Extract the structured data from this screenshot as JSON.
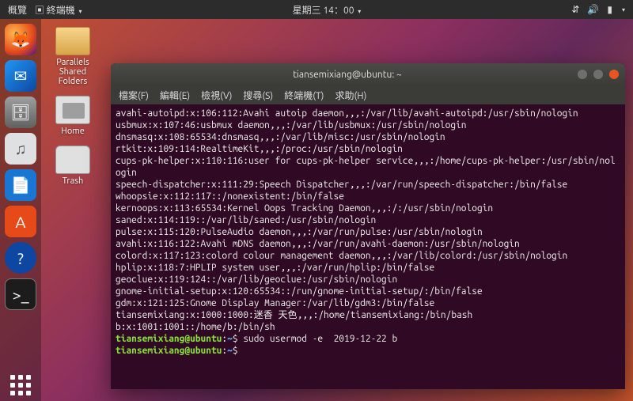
{
  "panel": {
    "activities": "概覽",
    "app_menu": "終端機",
    "clock": "星期三 14：00"
  },
  "desktop": {
    "parallels": "Parallels\nShared\nFolders",
    "home": "Home",
    "trash": "Trash"
  },
  "terminal": {
    "title": "tiansemixiang@ubuntu: ~",
    "menus": [
      "檔案(F)",
      "編輯(E)",
      "檢視(V)",
      "搜尋(S)",
      "終端機(T)",
      "求助(H)"
    ],
    "lines": [
      "avahi-autoipd:x:106:112:Avahi autoip daemon,,,:/var/lib/avahi-autoipd:/usr/sbin/nologin",
      "usbmux:x:107:46:usbmux daemon,,,:/var/lib/usbmux:/usr/sbin/nologin",
      "dnsmasq:x:108:65534:dnsmasq,,,:/var/lib/misc:/usr/sbin/nologin",
      "rtkit:x:109:114:RealtimeKit,,,:/proc:/usr/sbin/nologin",
      "cups-pk-helper:x:110:116:user for cups-pk-helper service,,,:/home/cups-pk-helper:/usr/sbin/nologin",
      "speech-dispatcher:x:111:29:Speech Dispatcher,,,:/var/run/speech-dispatcher:/bin/false",
      "whoopsie:x:112:117::/nonexistent:/bin/false",
      "kernoops:x:113:65534:Kernel Oops Tracking Daemon,,,:/:/usr/sbin/nologin",
      "saned:x:114:119::/var/lib/saned:/usr/sbin/nologin",
      "pulse:x:115:120:PulseAudio daemon,,,:/var/run/pulse:/usr/sbin/nologin",
      "avahi:x:116:122:Avahi mDNS daemon,,,:/var/run/avahi-daemon:/usr/sbin/nologin",
      "colord:x:117:123:colord colour management daemon,,,:/var/lib/colord:/usr/sbin/nologin",
      "hplip:x:118:7:HPLIP system user,,,:/var/run/hplip:/bin/false",
      "geoclue:x:119:124::/var/lib/geoclue:/usr/sbin/nologin",
      "gnome-initial-setup:x:120:65534::/run/gnome-initial-setup/:/bin/false",
      "gdm:x:121:125:Gnome Display Manager:/var/lib/gdm3:/bin/false",
      "tiansemixiang:x:1000:1000:迷香 天色,,,:/home/tiansemixiang:/bin/bash",
      "b:x:1001:1001::/home/b:/bin/sh"
    ],
    "prompt_user_host": "tiansemixiang@ubuntu",
    "prompt_path": "~",
    "last_command": "sudo usermod -e  2019-12-22 b",
    "current_command": ""
  }
}
